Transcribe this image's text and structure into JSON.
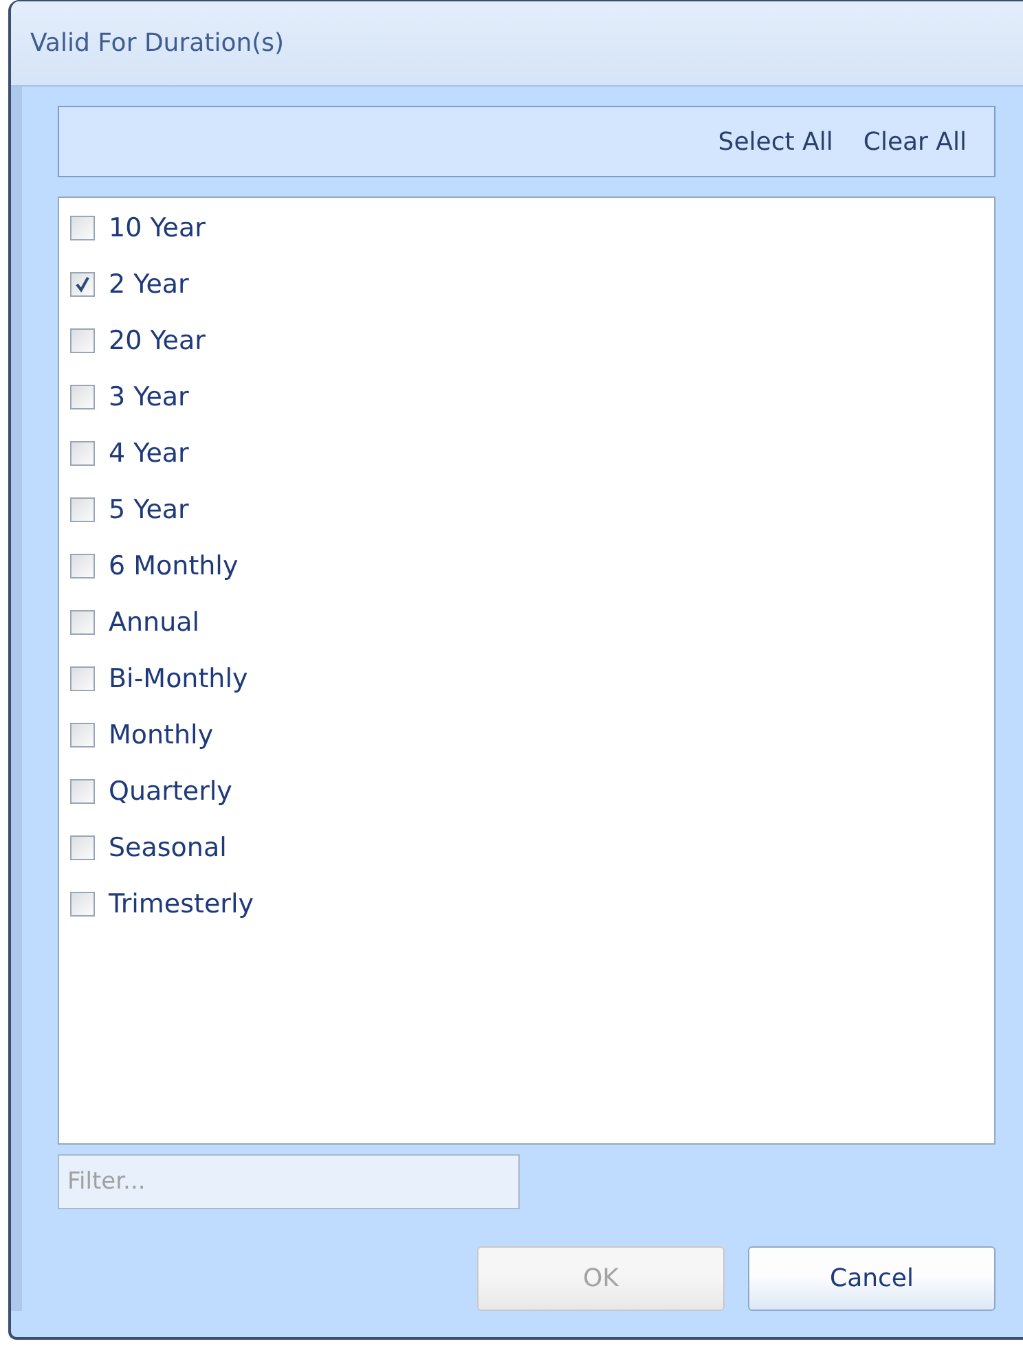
{
  "window": {
    "title": "Valid For Duration(s)"
  },
  "toolbar": {
    "actions": [
      "Select All",
      "Clear All"
    ]
  },
  "items": [
    {
      "label": "10 Year",
      "checked": false
    },
    {
      "label": "2 Year",
      "checked": true
    },
    {
      "label": "20 Year",
      "checked": false
    },
    {
      "label": "3 Year",
      "checked": false
    },
    {
      "label": "4 Year",
      "checked": false
    },
    {
      "label": "5 Year",
      "checked": false
    },
    {
      "label": "6 Monthly",
      "checked": false
    },
    {
      "label": "Annual",
      "checked": false
    },
    {
      "label": "Bi-Monthly",
      "checked": false
    },
    {
      "label": "Monthly",
      "checked": false
    },
    {
      "label": "Quarterly",
      "checked": false
    },
    {
      "label": "Seasonal",
      "checked": false
    },
    {
      "label": "Trimesterly",
      "checked": false
    }
  ],
  "filter": {
    "placeholder": "Filter..."
  },
  "buttons": [
    {
      "label": "OK",
      "disabled": true
    },
    {
      "label": "Cancel",
      "disabled": false
    }
  ]
}
